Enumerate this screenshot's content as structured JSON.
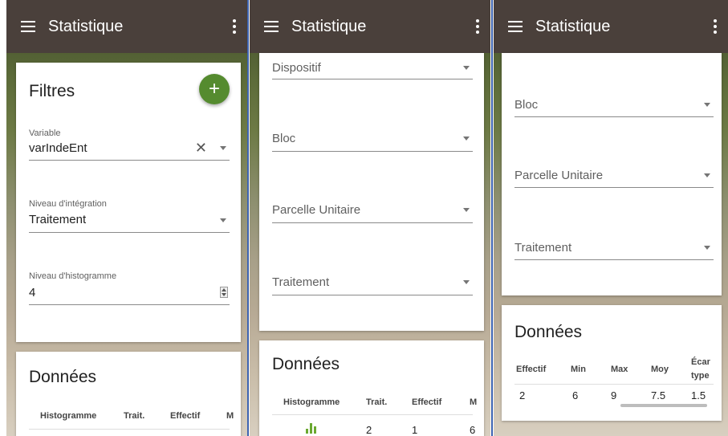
{
  "app": {
    "title": "Statistique",
    "menu_icon": "hamburger-menu-icon",
    "more_icon": "more-vert-icon"
  },
  "colors": {
    "appbar": "#4a403b",
    "fab": "#558b2f",
    "divider": "#3d63b0",
    "histogram_icon": "#6aa830"
  },
  "panel1": {
    "filters": {
      "title": "Filtres",
      "add_label": "+",
      "variable": {
        "label": "Variable",
        "value": "varIndeEnt"
      },
      "integration": {
        "label": "Niveau d'intégration",
        "value": "Traitement"
      },
      "histogram_level": {
        "label": "Niveau d'histogramme",
        "value": "4"
      }
    },
    "data": {
      "title": "Données",
      "headers": [
        "Histogramme",
        "Trait.",
        "Effectif",
        "M"
      ]
    }
  },
  "panel2": {
    "fields": [
      "Dispositif",
      "Bloc",
      "Parcelle Unitaire",
      "Traitement"
    ],
    "data": {
      "title": "Données",
      "headers": [
        "Histogramme",
        "Trait.",
        "Effectif",
        "M"
      ],
      "row": {
        "trait": "2",
        "effectif": "1",
        "m": "6"
      }
    }
  },
  "panel3": {
    "fields": [
      "Bloc",
      "Parcelle Unitaire",
      "Traitement"
    ],
    "data": {
      "title": "Données",
      "headers": [
        "Effectif",
        "Min",
        "Max",
        "Moy",
        "Écar",
        "type"
      ],
      "row": [
        "2",
        "6",
        "9",
        "7.5",
        "1.5"
      ]
    }
  }
}
